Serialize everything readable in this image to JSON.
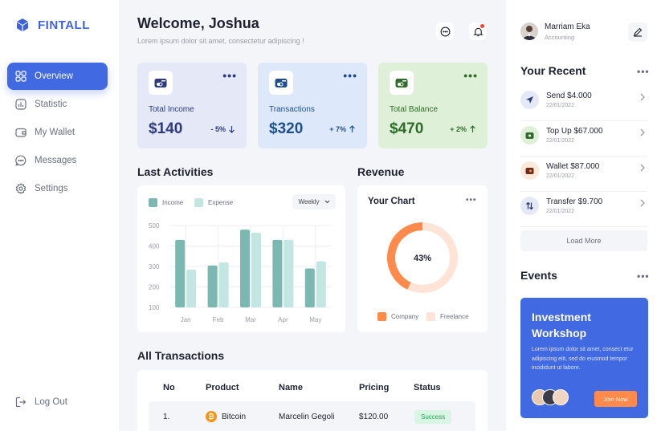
{
  "sidebar": {
    "logo": "FINTALL",
    "items": [
      {
        "label": "Overview",
        "active": true
      },
      {
        "label": "Statistic"
      },
      {
        "label": "My Wallet"
      },
      {
        "label": "Messages"
      },
      {
        "label": "Settings"
      }
    ],
    "logout": "Log Out"
  },
  "header": {
    "title": "Welcome, Joshua",
    "subtitle": "Lorem ipsum dolor sit amet, consectetur adipiscing !"
  },
  "cards": [
    {
      "label": "Total Income",
      "value": "$140",
      "change": "- 5%",
      "direction": "down",
      "bg": "#e4e8f7",
      "accent": "#2d3a7c"
    },
    {
      "label": "Transactions",
      "value": "$320",
      "change": "+ 7%",
      "direction": "up",
      "bg": "#dde9fb",
      "accent": "#1f4e8c"
    },
    {
      "label": "Total Balance",
      "value": "$470",
      "change": "+ 2%",
      "direction": "up",
      "bg": "#dff0d8",
      "accent": "#2f6b2a"
    }
  ],
  "activities": {
    "title": "Last Activities",
    "legend": {
      "income": "Income",
      "expense": "Expense"
    },
    "period": "Weekly",
    "chart_data": {
      "type": "bar",
      "categories": [
        "Jan",
        "Feb",
        "Mar",
        "Apr",
        "May"
      ],
      "series": [
        {
          "name": "Income",
          "values": [
            430,
            305,
            480,
            430,
            290
          ],
          "color": "#7ab8b1"
        },
        {
          "name": "Expense",
          "values": [
            285,
            320,
            465,
            430,
            325
          ],
          "color": "#c3e6e2"
        }
      ],
      "yticks": [
        500,
        400,
        300,
        200,
        100
      ],
      "ylim": [
        100,
        500
      ]
    }
  },
  "revenue": {
    "title": "Revenue",
    "chart_title": "Your Chart",
    "chart_data": {
      "type": "pie",
      "labels": [
        "Company",
        "Freelance"
      ],
      "values": [
        43,
        57
      ],
      "colors": [
        "#ff8a4c",
        "#fde4d6"
      ],
      "center_label": "43%"
    }
  },
  "transactions": {
    "title": "All Transactions",
    "columns": [
      "No",
      "Product",
      "Name",
      "Pricing",
      "Status"
    ],
    "rows": [
      {
        "no": "1.",
        "product": "Bitcoin",
        "name": "Marcelin Gegoli",
        "pricing": "$120.00",
        "status": "Success"
      }
    ]
  },
  "profile": {
    "name": "Marriam Eka",
    "role": "Accounting"
  },
  "recent": {
    "title": "Your Recent",
    "items": [
      {
        "title": "Send $4.000",
        "date": "22/01/2022",
        "icon": "send-icon",
        "bg": "#e4e8f7"
      },
      {
        "title": "Top Up $67.000",
        "date": "22/01/2022",
        "icon": "wallet-icon",
        "bg": "#dff0d8"
      },
      {
        "title": "Wallet $87.000",
        "date": "22/01/2022",
        "icon": "card-icon",
        "bg": "#fde8dc"
      },
      {
        "title": "Transfer $9.700",
        "date": "22/01/2022",
        "icon": "transfer-icon",
        "bg": "#e4e8f7"
      }
    ],
    "load_more": "Load More"
  },
  "events": {
    "title": "Events",
    "card_title": "Investment Workshop",
    "card_desc": "Lorem ipsum dolor sit amet, consect etur adipiscing elit, sed do eiusmod tempor incididunt ut labore.",
    "button": "Join Now"
  }
}
